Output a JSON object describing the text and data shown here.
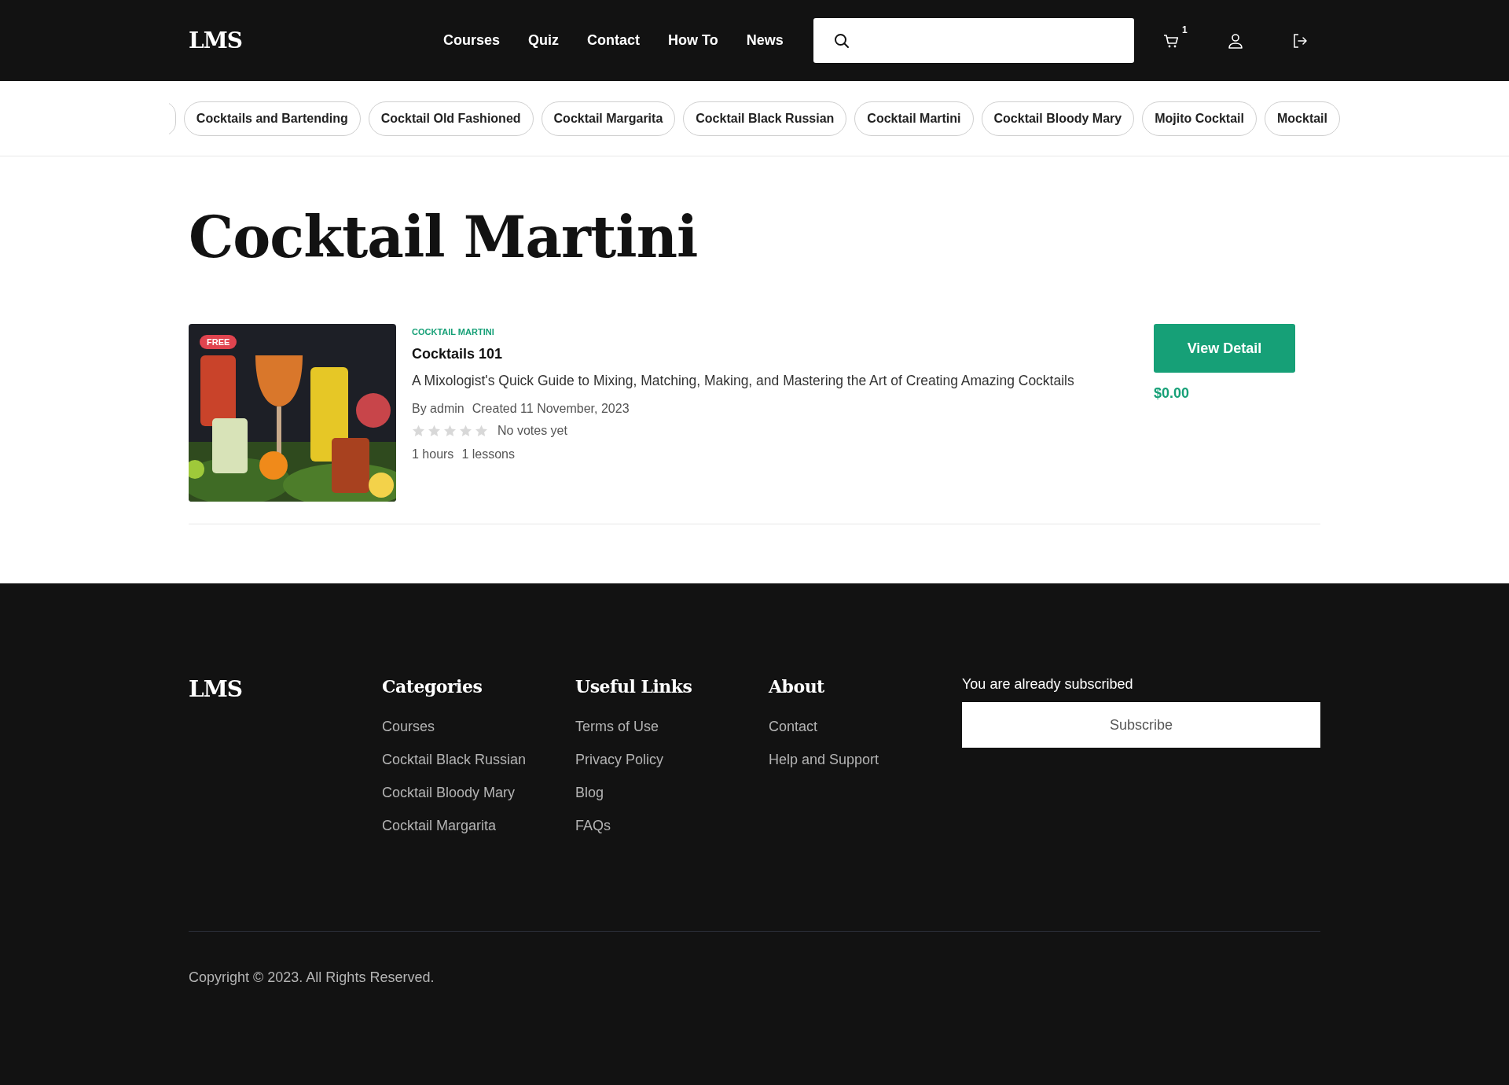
{
  "header": {
    "logo": "LMS",
    "nav": [
      {
        "label": "Courses"
      },
      {
        "label": "Quiz"
      },
      {
        "label": "Contact"
      },
      {
        "label": "How To"
      },
      {
        "label": "News"
      }
    ],
    "cart_count": "1"
  },
  "tags": [
    {
      "label": "Cocktails and Bartending"
    },
    {
      "label": "Cocktail Old Fashioned"
    },
    {
      "label": "Cocktail Margarita"
    },
    {
      "label": "Cocktail Black Russian"
    },
    {
      "label": "Cocktail Martini"
    },
    {
      "label": "Cocktail Bloody Mary"
    },
    {
      "label": "Mojito Cocktail"
    },
    {
      "label": "Mocktail"
    }
  ],
  "page_title": "Cocktail Martini",
  "courses": [
    {
      "badge": "FREE",
      "category": "COCKTAIL MARTINI",
      "title": "Cocktails 101",
      "description": "A Mixologist's Quick Guide to Mixing, Matching, Making, and Mastering the Art of Creating Amazing Cocktails",
      "author": "By admin",
      "created": "Created 11 November, 2023",
      "stars": 0,
      "votes": "No votes yet",
      "duration": "1 hours",
      "lessons": "1 lessons",
      "button": "View Detail",
      "price": "$0.00"
    }
  ],
  "footer": {
    "logo": "LMS",
    "columns": [
      {
        "title": "Categories",
        "links": [
          "Courses",
          "Cocktail Black Russian",
          "Cocktail Bloody Mary",
          "Cocktail Margarita"
        ]
      },
      {
        "title": "Useful Links",
        "links": [
          "Terms of Use",
          "Privacy Policy",
          "Blog",
          "FAQs"
        ]
      },
      {
        "title": "About",
        "links": [
          "Contact",
          "Help and Support"
        ]
      }
    ],
    "subscribe_note": "You are already subscribed",
    "subscribe_button": "Subscribe",
    "copyright": "Copyright © 2023. All Rights Reserved."
  }
}
